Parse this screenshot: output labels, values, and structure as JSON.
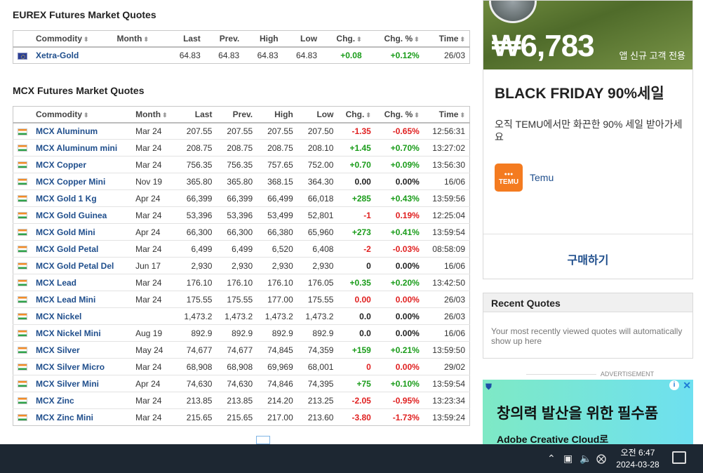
{
  "eurex": {
    "title": "EUREX Futures Market Quotes",
    "headers": [
      "Commodity",
      "Month",
      "Last",
      "Prev.",
      "High",
      "Low",
      "Chg.",
      "Chg. %",
      "Time"
    ],
    "rows": [
      {
        "flag": "eu",
        "name": "Xetra-Gold",
        "month": "",
        "last": "64.83",
        "prev": "64.83",
        "high": "64.83",
        "low": "64.83",
        "chg": "+0.08",
        "chgpct": "+0.12%",
        "time": "26/03",
        "chg_dir": "pos",
        "pct_dir": "pos"
      }
    ]
  },
  "mcx": {
    "title": "MCX Futures Market Quotes",
    "headers": [
      "Commodity",
      "Month",
      "Last",
      "Prev.",
      "High",
      "Low",
      "Chg.",
      "Chg. %",
      "Time"
    ],
    "rows": [
      {
        "flag": "in",
        "name": "MCX Aluminum",
        "month": "Mar 24",
        "last": "207.55",
        "prev": "207.55",
        "high": "207.55",
        "low": "207.50",
        "chg": "-1.35",
        "chgpct": "-0.65%",
        "time": "12:56:31",
        "chg_dir": "neg",
        "pct_dir": "neg"
      },
      {
        "flag": "in",
        "name": "MCX Aluminum mini",
        "month": "Mar 24",
        "last": "208.75",
        "prev": "208.75",
        "high": "208.75",
        "low": "208.10",
        "chg": "+1.45",
        "chgpct": "+0.70%",
        "time": "13:27:02",
        "chg_dir": "pos",
        "pct_dir": "pos"
      },
      {
        "flag": "in",
        "name": "MCX Copper",
        "month": "Mar 24",
        "last": "756.35",
        "prev": "756.35",
        "high": "757.65",
        "low": "752.00",
        "chg": "+0.70",
        "chgpct": "+0.09%",
        "time": "13:56:30",
        "chg_dir": "pos",
        "pct_dir": "pos"
      },
      {
        "flag": "in",
        "name": "MCX Copper Mini",
        "month": "Nov 19",
        "last": "365.80",
        "prev": "365.80",
        "high": "368.15",
        "low": "364.30",
        "chg": "0.00",
        "chgpct": "0.00%",
        "time": "16/06",
        "chg_dir": "neu",
        "pct_dir": "neu"
      },
      {
        "flag": "in",
        "name": "MCX Gold 1 Kg",
        "month": "Apr 24",
        "last": "66,399",
        "prev": "66,399",
        "high": "66,499",
        "low": "66,018",
        "chg": "+285",
        "chgpct": "+0.43%",
        "time": "13:59:56",
        "chg_dir": "pos",
        "pct_dir": "pos"
      },
      {
        "flag": "in",
        "name": "MCX Gold Guinea",
        "month": "Mar 24",
        "last": "53,396",
        "prev": "53,396",
        "high": "53,499",
        "low": "52,801",
        "chg": "-1",
        "chgpct": "0.19%",
        "time": "12:25:04",
        "chg_dir": "neg",
        "pct_dir": "neg"
      },
      {
        "flag": "in",
        "name": "MCX Gold Mini",
        "month": "Apr 24",
        "last": "66,300",
        "prev": "66,300",
        "high": "66,380",
        "low": "65,960",
        "chg": "+273",
        "chgpct": "+0.41%",
        "time": "13:59:54",
        "chg_dir": "pos",
        "pct_dir": "pos"
      },
      {
        "flag": "in",
        "name": "MCX Gold Petal",
        "month": "Mar 24",
        "last": "6,499",
        "prev": "6,499",
        "high": "6,520",
        "low": "6,408",
        "chg": "-2",
        "chgpct": "-0.03%",
        "time": "08:58:09",
        "chg_dir": "neg",
        "pct_dir": "neg"
      },
      {
        "flag": "in",
        "name": "MCX Gold Petal Del",
        "month": "Jun 17",
        "last": "2,930",
        "prev": "2,930",
        "high": "2,930",
        "low": "2,930",
        "chg": "0",
        "chgpct": "0.00%",
        "time": "16/06",
        "chg_dir": "neu",
        "pct_dir": "neu"
      },
      {
        "flag": "in",
        "name": "MCX Lead",
        "month": "Mar 24",
        "last": "176.10",
        "prev": "176.10",
        "high": "176.10",
        "low": "176.05",
        "chg": "+0.35",
        "chgpct": "+0.20%",
        "time": "13:42:50",
        "chg_dir": "pos",
        "pct_dir": "pos"
      },
      {
        "flag": "in",
        "name": "MCX Lead Mini",
        "month": "Mar 24",
        "last": "175.55",
        "prev": "175.55",
        "high": "177.00",
        "low": "175.55",
        "chg": "0.00",
        "chgpct": "0.00%",
        "time": "26/03",
        "chg_dir": "neg",
        "pct_dir": "neg"
      },
      {
        "flag": "in",
        "name": "MCX Nickel",
        "month": "",
        "last": "1,473.2",
        "prev": "1,473.2",
        "high": "1,473.2",
        "low": "1,473.2",
        "chg": "0.0",
        "chgpct": "0.00%",
        "time": "26/03",
        "chg_dir": "neu",
        "pct_dir": "neu"
      },
      {
        "flag": "in",
        "name": "MCX Nickel Mini",
        "month": "Aug 19",
        "last": "892.9",
        "prev": "892.9",
        "high": "892.9",
        "low": "892.9",
        "chg": "0.0",
        "chgpct": "0.00%",
        "time": "16/06",
        "chg_dir": "neu",
        "pct_dir": "neu"
      },
      {
        "flag": "in",
        "name": "MCX Silver",
        "month": "May 24",
        "last": "74,677",
        "prev": "74,677",
        "high": "74,845",
        "low": "74,359",
        "chg": "+159",
        "chgpct": "+0.21%",
        "time": "13:59:50",
        "chg_dir": "pos",
        "pct_dir": "pos"
      },
      {
        "flag": "in",
        "name": "MCX Silver Micro",
        "month": "Mar 24",
        "last": "68,908",
        "prev": "68,908",
        "high": "69,969",
        "low": "68,001",
        "chg": "0",
        "chgpct": "0.00%",
        "time": "29/02",
        "chg_dir": "neg",
        "pct_dir": "neg"
      },
      {
        "flag": "in",
        "name": "MCX Silver Mini",
        "month": "Apr 24",
        "last": "74,630",
        "prev": "74,630",
        "high": "74,846",
        "low": "74,395",
        "chg": "+75",
        "chgpct": "+0.10%",
        "time": "13:59:54",
        "chg_dir": "pos",
        "pct_dir": "pos"
      },
      {
        "flag": "in",
        "name": "MCX Zinc",
        "month": "Mar 24",
        "last": "213.85",
        "prev": "213.85",
        "high": "214.20",
        "low": "213.25",
        "chg": "-2.05",
        "chgpct": "-0.95%",
        "time": "13:23:34",
        "chg_dir": "neg",
        "pct_dir": "neg"
      },
      {
        "flag": "in",
        "name": "MCX Zinc Mini",
        "month": "Mar 24",
        "last": "215.65",
        "prev": "215.65",
        "high": "217.00",
        "low": "213.60",
        "chg": "-3.80",
        "chgpct": "-1.73%",
        "time": "13:59:24",
        "chg_dir": "neg",
        "pct_dir": "neg"
      }
    ]
  },
  "ad": {
    "price": "₩6,783",
    "price_note": "앱 신규 고객 전용",
    "headline": "BLACK FRIDAY 90%세일",
    "description": "오직 TEMU에서만 화끈한 90% 세일 받아가세요",
    "logo_text": "TEMU",
    "brand": "Temu",
    "cta": "구매하기"
  },
  "recent_quotes": {
    "title": "Recent Quotes",
    "body": "Your most recently viewed quotes will automatically show up here"
  },
  "advertisement": {
    "label": "ADVERTISEMENT",
    "title": "창의력 발산을 위한 필수품",
    "subtitle": "Adobe Creative Cloud로"
  },
  "taskbar": {
    "time": "오전 6:47",
    "date": "2024-03-28",
    "icons": [
      "chevron-up-icon",
      "network-icon",
      "volume-icon",
      "close-circle-icon",
      "notification-icon"
    ]
  },
  "colors": {
    "positive": "#1a9c1a",
    "negative": "#e02020",
    "link": "#1f4e8c",
    "taskbar": "#1d2732",
    "temu_orange": "#f47b20"
  }
}
